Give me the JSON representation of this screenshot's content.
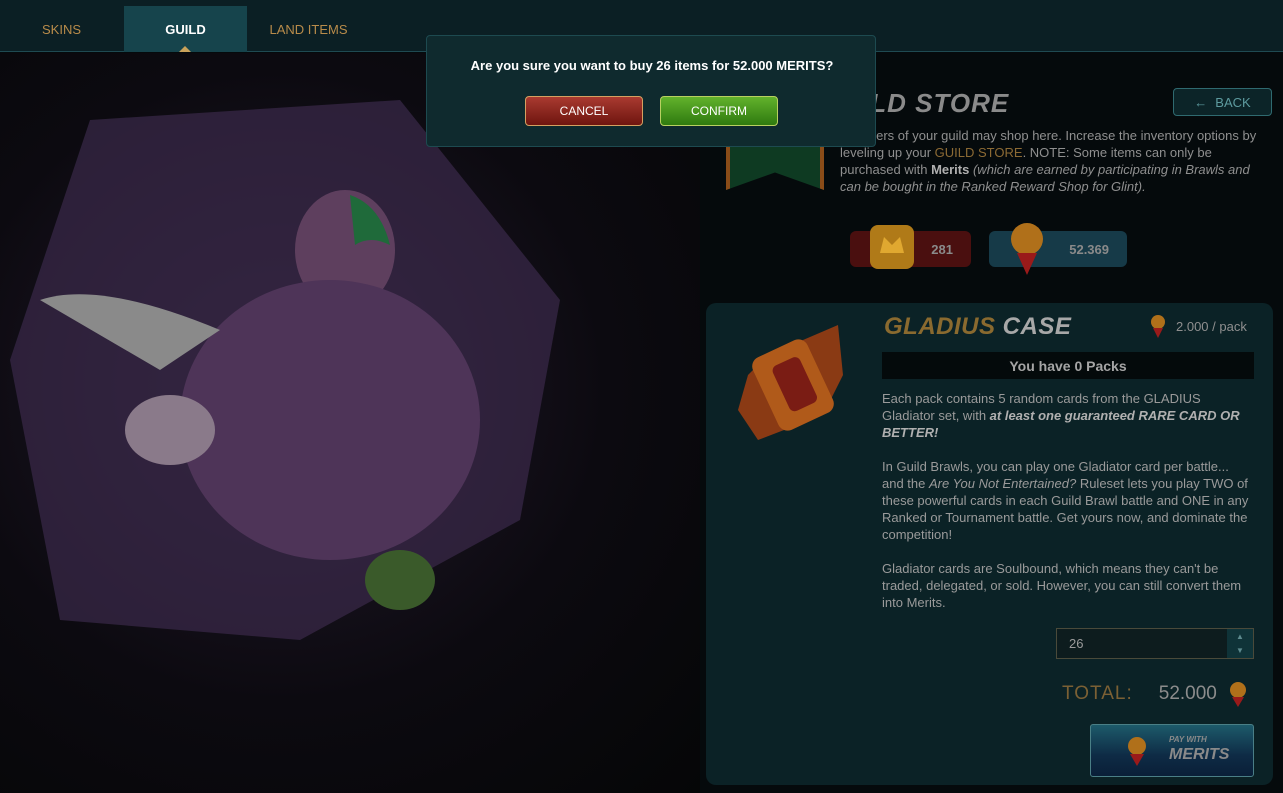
{
  "tabs": [
    {
      "label": "SKINS",
      "active": false
    },
    {
      "label": "GUILD",
      "active": true
    },
    {
      "label": "LAND ITEMS",
      "active": false
    }
  ],
  "modal": {
    "message": "Are you sure you want to buy 26 items for 52.000 MERITS?",
    "cancel_label": "CANCEL",
    "confirm_label": "CONFIRM"
  },
  "store": {
    "title": "ILD STORE",
    "back_label": "BACK",
    "desc_1": "members of your guild may shop here. Increase the inventory options by leveling up your ",
    "desc_guild": "GUILD STORE",
    "desc_2": ". NOTE: Some items can only be purchased with ",
    "desc_merits": "Merits",
    "desc_3": " (which are earned by participating in Brawls and can be bought in the Ranked Reward Shop for Glint).",
    "crowns": "281",
    "merits": "52.369"
  },
  "product": {
    "title_1": "GLADIUS",
    "title_2": "CASE",
    "price": "2.000 / pack",
    "packs": "You have 0 Packs",
    "p1_a": "Each pack contains 5 random cards from the GLADIUS Gladiator set, with ",
    "p1_b": "at least one guaranteed RARE CARD OR BETTER!",
    "p2_a": "In Guild Brawls, you can play one Gladiator card per battle... and the ",
    "p2_b": "Are You Not Entertained?",
    "p2_c": " Ruleset lets you play TWO of these powerful cards in each Guild Brawl battle and ONE in any Ranked or Tournament battle. Get yours now, and dominate the competition!",
    "p3": "Gladiator cards are Soulbound, which means they can't be traded, delegated, or sold. However, you can still convert them into Merits.",
    "quantity": "26",
    "total_label": "TOTAL:",
    "total_value": "52.000",
    "pay_line1": "PAY WITH",
    "pay_line2": "MERITS"
  },
  "colors": {
    "accent_gold": "#b88b4a",
    "panel": "#0b2226",
    "confirm_green": "#4a9a1f",
    "cancel_red": "#8e2a22"
  },
  "icons": {
    "back": "arrow-left-icon",
    "crowns": "crown-badge-icon",
    "merits": "merit-medal-icon"
  }
}
